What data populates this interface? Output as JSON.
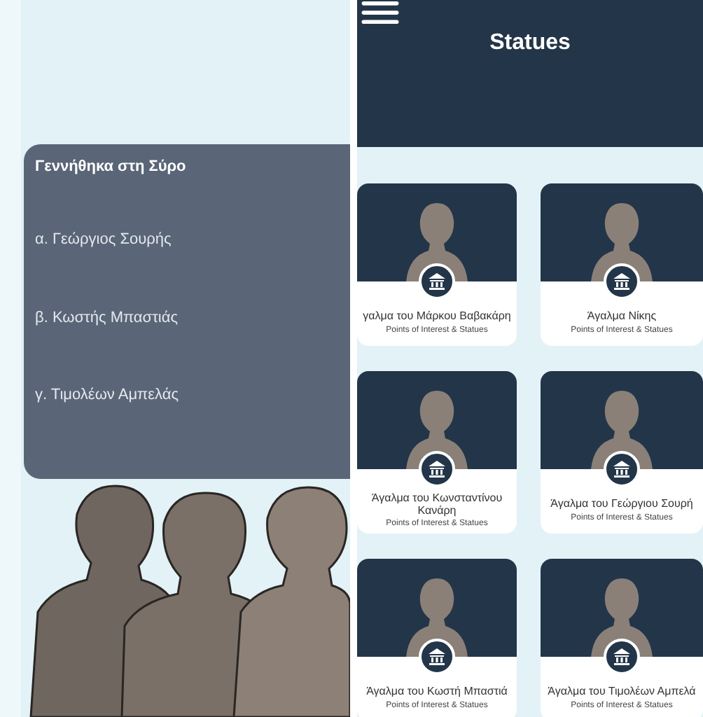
{
  "quiz": {
    "question": "Γεννήθηκα στη Σύρο",
    "options": [
      {
        "label": "α. Γεώργιος Σουρής"
      },
      {
        "label": "β. Κωστής Μπαστιάς"
      },
      {
        "label": "γ. Τιμολέων Αμπελάς"
      }
    ]
  },
  "header": {
    "title": "Statues"
  },
  "statues": [
    {
      "name": "γαλμα του Μάρκου Βαβακάρη",
      "category": "Points of Interest & Statues"
    },
    {
      "name": "Άγαλμα Νίκης",
      "category": "Points of Interest & Statues"
    },
    {
      "name": "Άγαλμα του Κωνσταντίνου Κανάρη",
      "category": "Points of Interest & Statues"
    },
    {
      "name": "Άγαλμα του Γεώργιου Σουρή",
      "category": "Points of Interest & Statues"
    },
    {
      "name": "Άγαλμα του Κωστή Μπαστιά",
      "category": "Points of Interest & Statues"
    },
    {
      "name": "Άγαλμα του Τιμολέων Αμπελά",
      "category": "Points of Interest & Statues"
    }
  ]
}
